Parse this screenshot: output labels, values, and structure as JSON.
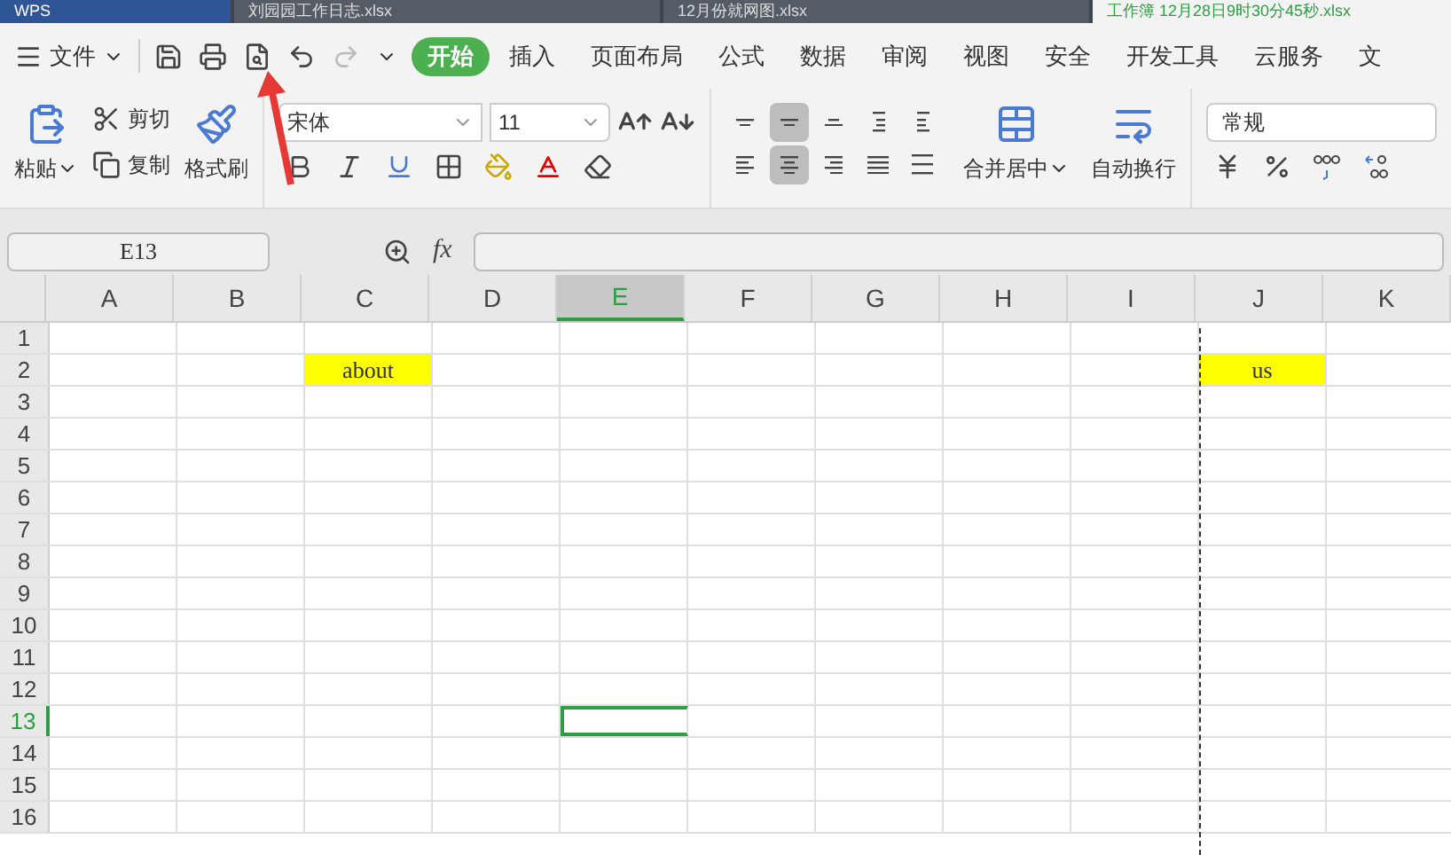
{
  "window_tabs": [
    {
      "label": "WPS",
      "kind": "app",
      "selected": false
    },
    {
      "label": "刘园园工作日志.xlsx",
      "kind": "file",
      "selected": false
    },
    {
      "label": "12月份就网图.xlsx",
      "kind": "file",
      "selected": false
    },
    {
      "label": "工作簿 12月28日9时30分45秒.xlsx",
      "kind": "file",
      "selected": true
    }
  ],
  "menu": {
    "file": "文件",
    "tabs": [
      {
        "label": "开始",
        "selected": true
      },
      {
        "label": "插入",
        "selected": false
      },
      {
        "label": "页面布局",
        "selected": false
      },
      {
        "label": "公式",
        "selected": false
      },
      {
        "label": "数据",
        "selected": false
      },
      {
        "label": "审阅",
        "selected": false
      },
      {
        "label": "视图",
        "selected": false
      },
      {
        "label": "安全",
        "selected": false
      },
      {
        "label": "开发工具",
        "selected": false
      },
      {
        "label": "云服务",
        "selected": false
      },
      {
        "label": "文",
        "selected": false
      }
    ]
  },
  "ribbon": {
    "paste": "粘贴",
    "cut": "剪切",
    "copy": "复制",
    "format_painter": "格式刷",
    "font_name": "宋体",
    "font_size": "11",
    "alignment": [
      {
        "kind": "top",
        "selected": false
      },
      {
        "kind": "middle",
        "selected": true
      },
      {
        "kind": "bottom",
        "selected": false
      },
      {
        "kind": "outdent",
        "selected": false
      },
      {
        "kind": "indent",
        "selected": false
      },
      {
        "kind": "left",
        "selected": false
      },
      {
        "kind": "center",
        "selected": true
      },
      {
        "kind": "right",
        "selected": false
      },
      {
        "kind": "justify",
        "selected": false
      },
      {
        "kind": "distribute",
        "selected": false
      }
    ],
    "merge": "合并居中",
    "wrap": "自动换行",
    "number_format": "常规"
  },
  "formula_bar": {
    "cell_ref": "E13",
    "function_label": "fx"
  },
  "sheet": {
    "columns": [
      {
        "label": "A",
        "selected": false,
        "page_break_before": false
      },
      {
        "label": "B",
        "selected": false,
        "page_break_before": false
      },
      {
        "label": "C",
        "selected": false,
        "page_break_before": false
      },
      {
        "label": "D",
        "selected": false,
        "page_break_before": false
      },
      {
        "label": "E",
        "selected": true,
        "page_break_before": false
      },
      {
        "label": "F",
        "selected": false,
        "page_break_before": false
      },
      {
        "label": "G",
        "selected": false,
        "page_break_before": false
      },
      {
        "label": "H",
        "selected": false,
        "page_break_before": false
      },
      {
        "label": "I",
        "selected": false,
        "page_break_before": false
      },
      {
        "label": "J",
        "selected": false,
        "page_break_before": true
      },
      {
        "label": "K",
        "selected": false,
        "page_break_before": false
      }
    ],
    "rows": [
      {
        "label": "1",
        "selected": false
      },
      {
        "label": "2",
        "selected": false,
        "cells": {
          "C": {
            "text": "about",
            "highlighted": true
          },
          "J": {
            "text": "us",
            "highlighted": true
          }
        }
      },
      {
        "label": "3",
        "selected": false
      },
      {
        "label": "4",
        "selected": false
      },
      {
        "label": "5",
        "selected": false
      },
      {
        "label": "6",
        "selected": false
      },
      {
        "label": "7",
        "selected": false
      },
      {
        "label": "8",
        "selected": false
      },
      {
        "label": "9",
        "selected": false
      },
      {
        "label": "10",
        "selected": false
      },
      {
        "label": "11",
        "selected": false
      },
      {
        "label": "12",
        "selected": false
      },
      {
        "label": "13",
        "selected": true
      },
      {
        "label": "14",
        "selected": false
      },
      {
        "label": "15",
        "selected": false
      },
      {
        "label": "16",
        "selected": false
      }
    ]
  }
}
